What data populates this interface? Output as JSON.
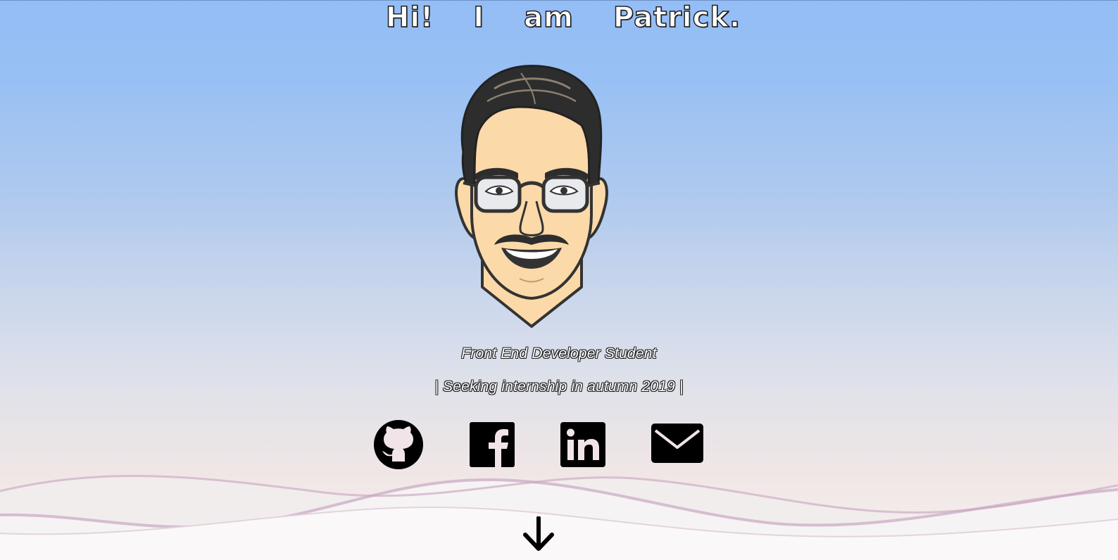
{
  "hero": {
    "title_words": [
      "Hi!",
      "I",
      "am",
      "Patrick."
    ],
    "subtitle_role": "Front End Developer Student",
    "subtitle_status": "| Seeking internship in autumn 2019 |"
  },
  "social_links": [
    {
      "icon": "github-icon"
    },
    {
      "icon": "facebook-icon"
    },
    {
      "icon": "linkedin-icon"
    },
    {
      "icon": "email-icon"
    }
  ],
  "scroll": {
    "icon": "arrow-down-icon"
  },
  "colors": {
    "background_top": "#93bdf5",
    "background_bottom": "#f7efef",
    "title_text": "#ffffff",
    "icon": "#000000",
    "wave": "#c9a6c0"
  }
}
